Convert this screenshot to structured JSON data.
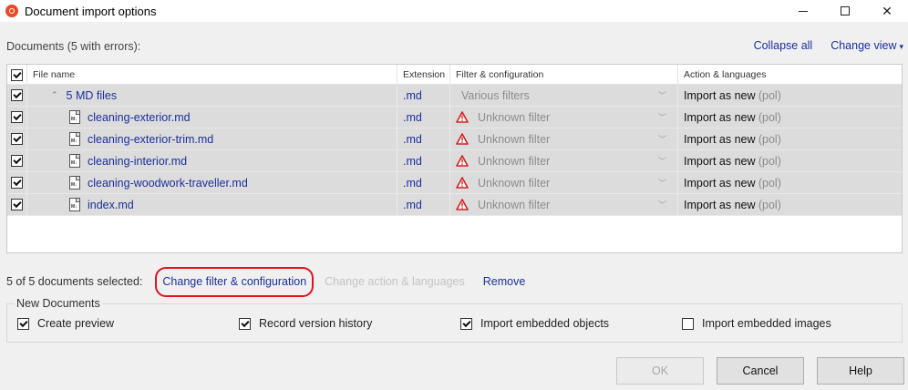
{
  "window": {
    "title": "Document import options",
    "minimize": "",
    "maximize": "",
    "close": "✕"
  },
  "header": {
    "documents_label": "Documents (5 with errors):",
    "collapse_all": "Collapse all",
    "change_view": "Change view",
    "change_view_caret": "▾"
  },
  "grid": {
    "columns": {
      "file_name": "File name",
      "extension": "Extension",
      "filter": "Filter & configuration",
      "action": "Action & languages"
    },
    "group": {
      "caret": "⌃",
      "name": "5 MD files",
      "extension": ".md",
      "filter": "Various filters",
      "action": "Import as new",
      "lang": "(pol)"
    },
    "rows": [
      {
        "name": "cleaning-exterior.md",
        "extension": ".md",
        "filter": "Unknown filter",
        "action": "Import as new",
        "lang": "(pol)"
      },
      {
        "name": "cleaning-exterior-trim.md",
        "extension": ".md",
        "filter": "Unknown filter",
        "action": "Import as new",
        "lang": "(pol)"
      },
      {
        "name": "cleaning-interior.md",
        "extension": ".md",
        "filter": "Unknown filter",
        "action": "Import as new",
        "lang": "(pol)"
      },
      {
        "name": "cleaning-woodwork-traveller.md",
        "extension": ".md",
        "filter": "Unknown filter",
        "action": "Import as new",
        "lang": "(pol)"
      },
      {
        "name": "index.md",
        "extension": ".md",
        "filter": "Unknown filter",
        "action": "Import as new",
        "lang": "(pol)"
      }
    ],
    "file_icon_tag": "M↓",
    "dropdown_caret": "﹀"
  },
  "selection": {
    "count": "5 of 5 documents selected:",
    "change_filter": "Change filter & configuration",
    "change_action": "Change action & languages",
    "remove": "Remove"
  },
  "new_documents": {
    "legend": "New Documents",
    "create_preview": "Create preview",
    "record_history": "Record version history",
    "import_objects": "Import embedded objects",
    "import_images": "Import embedded images"
  },
  "footer": {
    "ok": "OK",
    "cancel": "Cancel",
    "help": "Help"
  },
  "colors": {
    "link": "#1c2f9c",
    "highlight": "#e0131f",
    "warning": "#d42020",
    "app_icon": "#e84a27"
  }
}
